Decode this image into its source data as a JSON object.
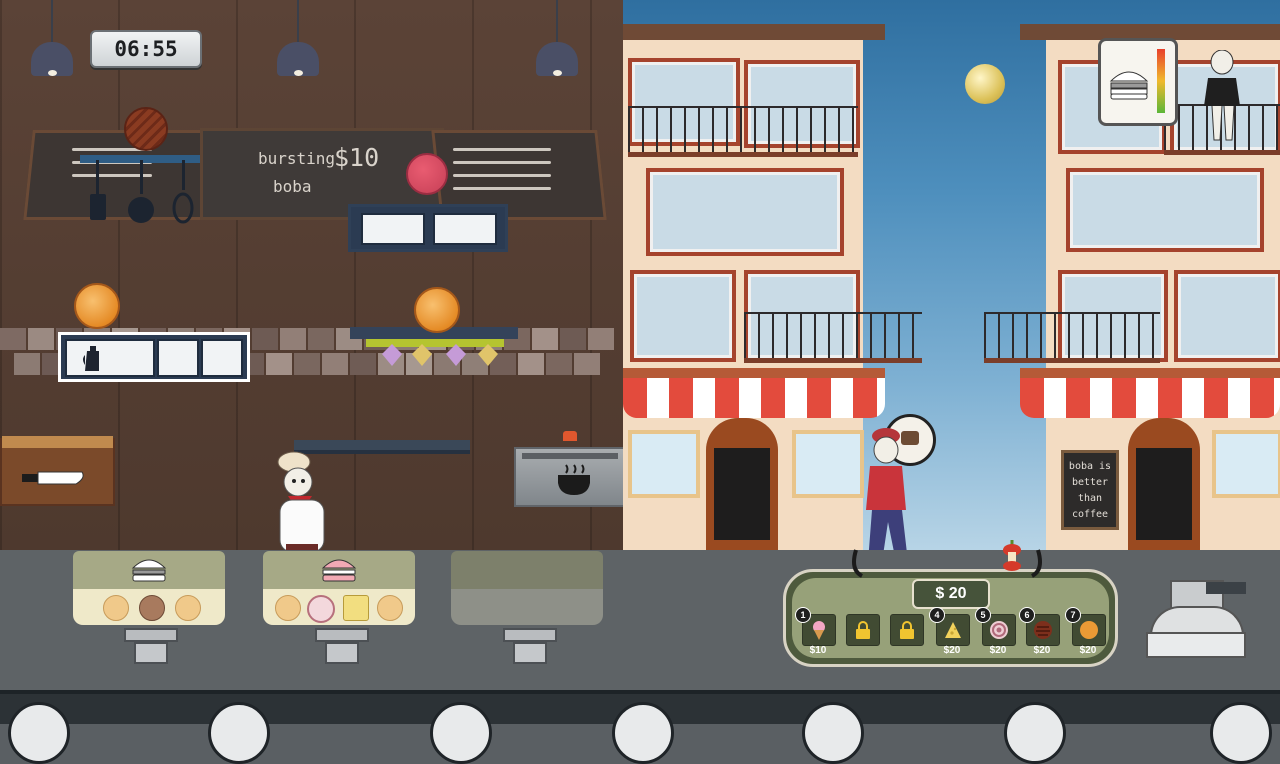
{
  "hud": {
    "timer": "06:55",
    "money": "$ 20"
  },
  "menu_board": {
    "word1": "bursting",
    "price": "$10",
    "word2": "boba"
  },
  "street_sign": {
    "lines": [
      "boba is",
      "better",
      "than",
      "coffee"
    ]
  },
  "customer_order": {
    "item_icon": "burger-icon"
  },
  "trays": [
    {
      "top_item": "burger-icon",
      "slots": [
        "bun",
        "patty",
        "bun"
      ]
    },
    {
      "top_item": "pink-burger-icon",
      "slots": [
        "bun",
        "onion",
        "cheese",
        "bun"
      ]
    },
    {
      "top_item": "",
      "slots": []
    }
  ],
  "shop": {
    "items": [
      {
        "num": "1",
        "icon": "ice-cream-icon",
        "price": "$10",
        "locked": false
      },
      {
        "num": "",
        "icon": "lock-icon",
        "price": "",
        "locked": true
      },
      {
        "num": "",
        "icon": "lock-icon",
        "price": "",
        "locked": true
      },
      {
        "num": "4",
        "icon": "cheese-icon",
        "price": "$20",
        "locked": false
      },
      {
        "num": "5",
        "icon": "onion-icon",
        "price": "$20",
        "locked": false
      },
      {
        "num": "6",
        "icon": "patty-icon",
        "price": "$20",
        "locked": false
      },
      {
        "num": "7",
        "icon": "bun-icon",
        "price": "$20",
        "locked": false
      }
    ]
  },
  "colors": {
    "kitchen_wall": "#5b4337",
    "awning_red": "#e34b3d",
    "shop_green": "#97a179",
    "sky": "#4e8fbd"
  }
}
